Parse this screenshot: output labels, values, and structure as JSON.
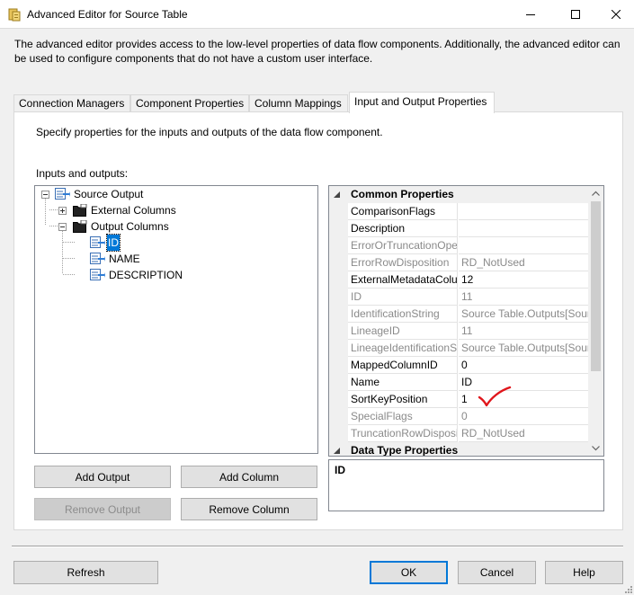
{
  "window": {
    "title": "Advanced Editor for Source Table",
    "description": "The advanced editor provides access to the low-level properties of data flow components. Additionally, the advanced editor can be used to configure components that do not have a custom user interface."
  },
  "tabs": [
    {
      "label": "Connection Managers"
    },
    {
      "label": "Component Properties"
    },
    {
      "label": "Column Mappings"
    },
    {
      "label": "Input and Output Properties"
    }
  ],
  "panel": {
    "description": "Specify properties for the inputs and outputs of the data flow component.",
    "inputs_label": "Inputs and outputs:"
  },
  "tree": {
    "root": "Source Output",
    "external": "External Columns",
    "output": "Output Columns",
    "columns": [
      "ID",
      "NAME",
      "DESCRIPTION"
    ]
  },
  "properties": {
    "category_common": "Common Properties",
    "category_datatype": "Data Type Properties",
    "rows": [
      {
        "name": "ComparisonFlags",
        "value": ""
      },
      {
        "name": "Description",
        "value": ""
      },
      {
        "name": "ErrorOrTruncationOpe",
        "value": ""
      },
      {
        "name": "ErrorRowDisposition",
        "value": "RD_NotUsed"
      },
      {
        "name": "ExternalMetadataColu",
        "value": "12"
      },
      {
        "name": "ID",
        "value": "11"
      },
      {
        "name": "IdentificationString",
        "value": "Source Table.Outputs[Sour"
      },
      {
        "name": "LineageID",
        "value": "11"
      },
      {
        "name": "LineageIdentificationS",
        "value": "Source Table.Outputs[Sour"
      },
      {
        "name": "MappedColumnID",
        "value": "0"
      },
      {
        "name": "Name",
        "value": "ID"
      },
      {
        "name": "SortKeyPosition",
        "value": "1"
      },
      {
        "name": "SpecialFlags",
        "value": "0"
      },
      {
        "name": "TruncationRowDisposi",
        "value": "RD_NotUsed"
      }
    ],
    "selected_description": "ID"
  },
  "buttons": {
    "add_output": "Add Output",
    "add_column": "Add Column",
    "remove_output": "Remove Output",
    "remove_column": "Remove Column",
    "refresh": "Refresh",
    "ok": "OK",
    "cancel": "Cancel",
    "help": "Help"
  },
  "colors": {
    "accent": "#0078d7",
    "annotation": "#e0151b"
  }
}
